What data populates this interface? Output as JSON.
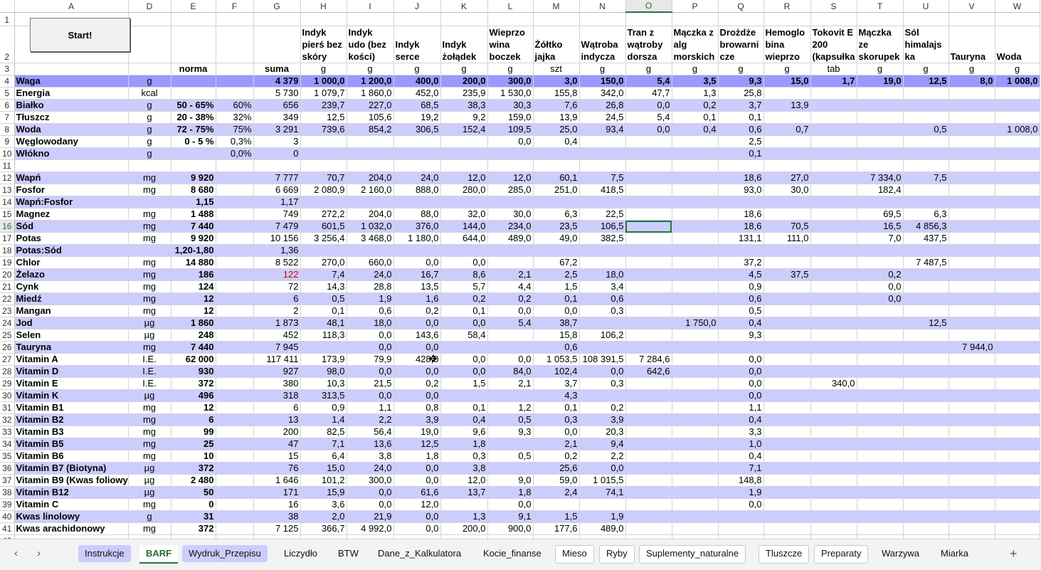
{
  "start_button": "Start!",
  "columns": [
    "A",
    "D",
    "E",
    "F",
    "G",
    "H",
    "I",
    "J",
    "K",
    "L",
    "M",
    "N",
    "O",
    "P",
    "Q",
    "R",
    "S",
    "T",
    "U",
    "V",
    "W"
  ],
  "selected_column": "O",
  "selected_row": "16",
  "row_numbers": [
    "1",
    "2",
    "3",
    "4",
    "5",
    "6",
    "7",
    "8",
    "9",
    "10",
    "11",
    "12",
    "13",
    "14",
    "15",
    "16",
    "17",
    "18",
    "19",
    "20",
    "21",
    "22",
    "23",
    "24",
    "25",
    "26",
    "27",
    "28",
    "29",
    "30",
    "31",
    "32",
    "33",
    "34",
    "35",
    "36",
    "37",
    "38",
    "39",
    "40",
    "41",
    "42"
  ],
  "ingredients": [
    "Indyk pierś bez skóry",
    "Indyk udo (bez kości)",
    "Indyk serce",
    "Indyk żołądek",
    "Wieprzowina boczek",
    "Żółtko jajka",
    "Wątroba indycza",
    "Tran z wątroby dorsza",
    "Mączka z alg morskich",
    "Drożdże browarnicze",
    "Hemoglobina wieprzo",
    "Tokovit E 200 (kapsułka",
    "Mączka ze skorupek",
    "Sól himalajska",
    "Tauryna",
    "Woda"
  ],
  "ingredients_display": [
    "Indyk pierś bez skóry",
    "Indyk udo (bez kości)",
    "Indyk serce",
    "Indyk żołądek",
    "Wieprzo wina boczek",
    "Żółtko jajka",
    "Wątroba indycza",
    "Tran z wątroby dorsza",
    "Mączka z alg morskich",
    "Drożdże browarni cze",
    "Hemoglo bina wieprzo",
    "Tokovit E 200 (kapsułka",
    "Mączka ze skorupek",
    "Sól himalajs ka",
    "Tauryna",
    "Woda"
  ],
  "row3": {
    "norma": "norma",
    "suma": "suma",
    "units": [
      "g",
      "g",
      "g",
      "g",
      "g",
      "szt",
      "g",
      "g",
      "g",
      "g",
      "g",
      "tab",
      "g",
      "g",
      "g",
      "g"
    ]
  },
  "rows": [
    {
      "n": "4",
      "name": "Waga",
      "unit": "g",
      "norma": "",
      "pct": "",
      "suma": "4 379",
      "vals": [
        "1 000,0",
        "1 200,0",
        "400,0",
        "200,0",
        "300,0",
        "3,0",
        "150,0",
        "5,4",
        "3,5",
        "9,3",
        "15,0",
        "1,7",
        "19,0",
        "12,5",
        "8,0",
        "1 008,0"
      ],
      "band": true,
      "bold": true
    },
    {
      "n": "5",
      "name": "Energia",
      "unit": "kcal",
      "norma": "",
      "pct": "",
      "suma": "5 730",
      "vals": [
        "1 079,7",
        "1 860,0",
        "452,0",
        "235,9",
        "1 530,0",
        "155,8",
        "342,0",
        "47,7",
        "1,3",
        "25,8",
        "",
        "",
        "",
        "",
        "",
        ""
      ],
      "band": false
    },
    {
      "n": "6",
      "name": "Białko",
      "unit": "g",
      "norma": "50 - 65%",
      "pct": "60%",
      "suma": "656",
      "vals": [
        "239,7",
        "227,0",
        "68,5",
        "38,3",
        "30,3",
        "7,6",
        "26,8",
        "0,0",
        "0,2",
        "3,7",
        "13,9",
        "",
        "",
        "",
        "",
        ""
      ],
      "band": true
    },
    {
      "n": "7",
      "name": "Tłuszcz",
      "unit": "g",
      "norma": "20 - 38%",
      "pct": "32%",
      "suma": "349",
      "vals": [
        "12,5",
        "105,6",
        "19,2",
        "9,2",
        "159,0",
        "13,9",
        "24,5",
        "5,4",
        "0,1",
        "0,1",
        "",
        "",
        "",
        "",
        "",
        ""
      ],
      "band": false
    },
    {
      "n": "8",
      "name": "Woda",
      "unit": "g",
      "norma": "72 - 75%",
      "pct": "75%",
      "suma": "3 291",
      "vals": [
        "739,6",
        "854,2",
        "306,5",
        "152,4",
        "109,5",
        "25,0",
        "93,4",
        "0,0",
        "0,4",
        "0,6",
        "0,7",
        "",
        "",
        "0,5",
        "",
        "1 008,0"
      ],
      "band": true
    },
    {
      "n": "9",
      "name": "Węglowodany",
      "unit": "g",
      "norma": "0 - 5 %",
      "pct": "0,3%",
      "suma": "3",
      "vals": [
        "",
        "",
        "",
        "",
        "0,0",
        "0,4",
        "",
        "",
        "",
        "2,5",
        "",
        "",
        "",
        "",
        "",
        ""
      ],
      "band": false
    },
    {
      "n": "10",
      "name": "Włókno",
      "unit": "g",
      "norma": "",
      "pct": "0,0%",
      "suma": "0",
      "vals": [
        "",
        "",
        "",
        "",
        "",
        "",
        "",
        "",
        "",
        "0,1",
        "",
        "",
        "",
        "",
        "",
        ""
      ],
      "band": true
    },
    {
      "n": "11",
      "name": "",
      "unit": "",
      "norma": "",
      "pct": "",
      "suma": "",
      "vals": [
        "",
        "",
        "",
        "",
        "",
        "",
        "",
        "",
        "",
        "",
        "",
        "",
        "",
        "",
        "",
        ""
      ],
      "band": false
    },
    {
      "n": "12",
      "name": "Wapń",
      "unit": "mg",
      "norma": "9 920",
      "pct": "",
      "suma": "7 777",
      "vals": [
        "70,7",
        "204,0",
        "24,0",
        "12,0",
        "12,0",
        "60,1",
        "7,5",
        "",
        "",
        "18,6",
        "27,0",
        "",
        "7 334,0",
        "7,5",
        "",
        ""
      ],
      "band": true
    },
    {
      "n": "13",
      "name": "Fosfor",
      "unit": "mg",
      "norma": "8 680",
      "pct": "",
      "suma": "6 669",
      "vals": [
        "2 080,9",
        "2 160,0",
        "888,0",
        "280,0",
        "285,0",
        "251,0",
        "418,5",
        "",
        "",
        "93,0",
        "30,0",
        "",
        "182,4",
        "",
        "",
        ""
      ],
      "band": false
    },
    {
      "n": "14",
      "name": "Wapń:Fosfor",
      "unit": "",
      "norma": "1,15",
      "pct": "",
      "suma": "1,17",
      "vals": [
        "",
        "",
        "",
        "",
        "",
        "",
        "",
        "",
        "",
        "",
        "",
        "",
        "",
        "",
        "",
        ""
      ],
      "band": true
    },
    {
      "n": "15",
      "name": "Magnez",
      "unit": "mg",
      "norma": "1 488",
      "pct": "",
      "suma": "749",
      "vals": [
        "272,2",
        "204,0",
        "88,0",
        "32,0",
        "30,0",
        "6,3",
        "22,5",
        "",
        "",
        "18,6",
        "",
        "",
        "69,5",
        "6,3",
        "",
        ""
      ],
      "band": false
    },
    {
      "n": "16",
      "name": "Sód",
      "unit": "mg",
      "norma": "7 440",
      "pct": "",
      "suma": "7 479",
      "vals": [
        "601,5",
        "1 032,0",
        "376,0",
        "144,0",
        "234,0",
        "23,5",
        "106,5",
        "",
        "",
        "18,6",
        "70,5",
        "",
        "16,5",
        "4 856,3",
        "",
        ""
      ],
      "band": true
    },
    {
      "n": "17",
      "name": "Potas",
      "unit": "mg",
      "norma": "9 920",
      "pct": "",
      "suma": "10 156",
      "vals": [
        "3 256,4",
        "3 468,0",
        "1 180,0",
        "644,0",
        "489,0",
        "49,0",
        "382,5",
        "",
        "",
        "131,1",
        "111,0",
        "",
        "7,0",
        "437,5",
        "",
        ""
      ],
      "band": false
    },
    {
      "n": "18",
      "name": "Potas:Sód",
      "unit": "",
      "norma": "1,20-1,80",
      "pct": "",
      "suma": "1,36",
      "vals": [
        "",
        "",
        "",
        "",
        "",
        "",
        "",
        "",
        "",
        "",
        "",
        "",
        "",
        "",
        "",
        ""
      ],
      "band": true
    },
    {
      "n": "19",
      "name": "Chlor",
      "unit": "mg",
      "norma": "14 880",
      "pct": "",
      "suma": "8 522",
      "vals": [
        "270,0",
        "660,0",
        "0,0",
        "0,0",
        "",
        "67,2",
        "",
        "",
        "",
        "37,2",
        "",
        "",
        "",
        "7 487,5",
        "",
        ""
      ],
      "band": false
    },
    {
      "n": "20",
      "name": "Żelazo",
      "unit": "mg",
      "norma": "186",
      "pct": "",
      "suma": "122",
      "sumaRed": true,
      "vals": [
        "7,4",
        "24,0",
        "16,7",
        "8,6",
        "2,1",
        "2,5",
        "18,0",
        "",
        "",
        "4,5",
        "37,5",
        "",
        "0,2",
        "",
        "",
        ""
      ],
      "band": true
    },
    {
      "n": "21",
      "name": "Cynk",
      "unit": "mg",
      "norma": "124",
      "pct": "",
      "suma": "72",
      "vals": [
        "14,3",
        "28,8",
        "13,5",
        "5,7",
        "4,4",
        "1,5",
        "3,4",
        "",
        "",
        "0,9",
        "",
        "",
        "0,0",
        "",
        "",
        ""
      ],
      "band": false
    },
    {
      "n": "22",
      "name": "Miedź",
      "unit": "mg",
      "norma": "12",
      "pct": "",
      "suma": "6",
      "vals": [
        "0,5",
        "1,9",
        "1,6",
        "0,2",
        "0,2",
        "0,1",
        "0,6",
        "",
        "",
        "0,6",
        "",
        "",
        "0,0",
        "",
        "",
        ""
      ],
      "band": true
    },
    {
      "n": "23",
      "name": "Mangan",
      "unit": "mg",
      "norma": "12",
      "pct": "",
      "suma": "2",
      "vals": [
        "0,1",
        "0,6",
        "0,2",
        "0,1",
        "0,0",
        "0,0",
        "0,3",
        "",
        "",
        "0,5",
        "",
        "",
        "",
        "",
        "",
        ""
      ],
      "band": false
    },
    {
      "n": "24",
      "name": "Jod",
      "unit": "µg",
      "norma": "1 860",
      "pct": "",
      "suma": "1 873",
      "vals": [
        "48,1",
        "18,0",
        "0,0",
        "0,0",
        "5,4",
        "38,7",
        "",
        "",
        "1 750,0",
        "0,4",
        "",
        "",
        "",
        "12,5",
        "",
        ""
      ],
      "band": true
    },
    {
      "n": "25",
      "name": "Selen",
      "unit": "µg",
      "norma": "248",
      "pct": "",
      "suma": "452",
      "vals": [
        "118,3",
        "0,0",
        "143,6",
        "58,4",
        "",
        "15,8",
        "106,2",
        "",
        "",
        "9,3",
        "",
        "",
        "",
        "",
        "",
        ""
      ],
      "band": false
    },
    {
      "n": "26",
      "name": "Tauryna",
      "unit": "mg",
      "norma": "7 440",
      "pct": "",
      "suma": "7 945",
      "vals": [
        "",
        "0,0",
        "0,0",
        "",
        "",
        "0,6",
        "",
        "",
        "",
        "",
        "",
        "",
        "",
        "",
        "7 944,0",
        ""
      ],
      "band": true
    },
    {
      "n": "27",
      "name": "Vitamin A",
      "unit": "I.E.",
      "norma": "62 000",
      "pct": "",
      "suma": "117 411",
      "vals": [
        "173,9",
        "79,9",
        "428,0",
        "0,0",
        "0,0",
        "1 053,5",
        "108 391,5",
        "7 284,6",
        "",
        "0,0",
        "",
        "",
        "",
        "",
        "",
        ""
      ],
      "band": false
    },
    {
      "n": "28",
      "name": "Vitamin D",
      "unit": "I.E.",
      "norma": "930",
      "pct": "",
      "suma": "927",
      "vals": [
        "98,0",
        "0,0",
        "0,0",
        "0,0",
        "84,0",
        "102,4",
        "0,0",
        "642,6",
        "",
        "0,0",
        "",
        "",
        "",
        "",
        "",
        ""
      ],
      "band": true
    },
    {
      "n": "29",
      "name": "Vitamin E",
      "unit": "I.E.",
      "norma": "372",
      "pct": "",
      "suma": "380",
      "vals": [
        "10,3",
        "21,5",
        "0,2",
        "1,5",
        "2,1",
        "3,7",
        "0,3",
        "",
        "",
        "0,0",
        "",
        "340,0",
        "",
        "",
        "",
        ""
      ],
      "band": false
    },
    {
      "n": "30",
      "name": "Vitamin K",
      "unit": "µg",
      "norma": "496",
      "pct": "",
      "suma": "318",
      "vals": [
        "313,5",
        "0,0",
        "0,0",
        "",
        "",
        "4,3",
        "",
        "",
        "",
        "0,0",
        "",
        "",
        "",
        "",
        "",
        ""
      ],
      "band": true
    },
    {
      "n": "31",
      "name": "Vitamin B1",
      "unit": "mg",
      "norma": "12",
      "pct": "",
      "suma": "6",
      "vals": [
        "0,9",
        "1,1",
        "0,8",
        "0,1",
        "1,2",
        "0,1",
        "0,2",
        "",
        "",
        "1,1",
        "",
        "",
        "",
        "",
        "",
        ""
      ],
      "band": false
    },
    {
      "n": "32",
      "name": "Vitamin B2",
      "unit": "mg",
      "norma": "6",
      "pct": "",
      "suma": "13",
      "vals": [
        "1,4",
        "2,2",
        "3,9",
        "0,4",
        "0,5",
        "0,3",
        "3,9",
        "",
        "",
        "0,4",
        "",
        "",
        "",
        "",
        "",
        ""
      ],
      "band": true
    },
    {
      "n": "33",
      "name": "Vitamin B3",
      "unit": "mg",
      "norma": "99",
      "pct": "",
      "suma": "200",
      "vals": [
        "82,5",
        "56,4",
        "19,0",
        "9,6",
        "9,3",
        "0,0",
        "20,3",
        "",
        "",
        "3,3",
        "",
        "",
        "",
        "",
        "",
        ""
      ],
      "band": false
    },
    {
      "n": "34",
      "name": "Vitamin B5",
      "unit": "mg",
      "norma": "25",
      "pct": "",
      "suma": "47",
      "vals": [
        "7,1",
        "13,6",
        "12,5",
        "1,8",
        "",
        "2,1",
        "9,4",
        "",
        "",
        "1,0",
        "",
        "",
        "",
        "",
        "",
        ""
      ],
      "band": true
    },
    {
      "n": "35",
      "name": "Vitamin B6",
      "unit": "mg",
      "norma": "10",
      "pct": "",
      "suma": "15",
      "vals": [
        "6,4",
        "3,8",
        "1,8",
        "0,3",
        "0,5",
        "0,2",
        "2,2",
        "",
        "",
        "0,4",
        "",
        "",
        "",
        "",
        "",
        ""
      ],
      "band": false
    },
    {
      "n": "36",
      "name": "Vitamin B7 (Biotyna)",
      "unit": "µg",
      "norma": "372",
      "pct": "",
      "suma": "76",
      "vals": [
        "15,0",
        "24,0",
        "0,0",
        "3,8",
        "",
        "25,6",
        "0,0",
        "",
        "",
        "7,1",
        "",
        "",
        "",
        "",
        "",
        ""
      ],
      "band": true
    },
    {
      "n": "37",
      "name": "Vitamin B9 (Kwas foliowy)",
      "unit": "µg",
      "norma": "2 480",
      "pct": "",
      "suma": "1 646",
      "vals": [
        "101,2",
        "300,0",
        "0,0",
        "12,0",
        "9,0",
        "59,0",
        "1 015,5",
        "",
        "",
        "148,8",
        "",
        "",
        "",
        "",
        "",
        ""
      ],
      "band": false
    },
    {
      "n": "38",
      "name": "Vitamin B12",
      "unit": "µg",
      "norma": "50",
      "pct": "",
      "suma": "171",
      "vals": [
        "15,9",
        "0,0",
        "61,6",
        "13,7",
        "1,8",
        "2,4",
        "74,1",
        "",
        "",
        "1,9",
        "",
        "",
        "",
        "",
        "",
        ""
      ],
      "band": true
    },
    {
      "n": "39",
      "name": "Vitamin C",
      "unit": "mg",
      "norma": "0",
      "pct": "",
      "suma": "16",
      "vals": [
        "3,6",
        "0,0",
        "12,0",
        "",
        "0,0",
        "",
        "",
        "",
        "",
        "0,0",
        "",
        "",
        "",
        "",
        "",
        ""
      ],
      "band": false
    },
    {
      "n": "40",
      "name": "Kwas linolowy",
      "unit": "g",
      "norma": "31",
      "pct": "",
      "suma": "38",
      "vals": [
        "2,0",
        "21,9",
        "0,0",
        "1,3",
        "9,1",
        "1,5",
        "1,9",
        "",
        "",
        "",
        "",
        "",
        "",
        "",
        "",
        ""
      ],
      "band": true
    },
    {
      "n": "41",
      "name": "Kwas arachidonowy",
      "unit": "mg",
      "norma": "372",
      "pct": "",
      "suma": "7 125",
      "vals": [
        "366,7",
        "4 992,0",
        "0,0",
        "200,0",
        "900,0",
        "177,6",
        "489,0",
        "",
        "",
        "",
        "",
        "",
        "",
        "",
        "",
        ""
      ],
      "band": false
    }
  ],
  "tabs": [
    {
      "label": "Instrukcje",
      "style": "purple"
    },
    {
      "label": "BARF",
      "style": "active"
    },
    {
      "label": "Wydruk_Przepisu",
      "style": "purple"
    },
    {
      "label": "Liczydło",
      "style": "plain"
    },
    {
      "label": "BTW",
      "style": "plain"
    },
    {
      "label": "Dane_z_Kalkulatora",
      "style": "plain"
    },
    {
      "label": "Kocie_finanse",
      "style": "plain"
    },
    {
      "label": "Mieso",
      "style": "white"
    },
    {
      "label": "Ryby",
      "style": "white"
    },
    {
      "label": "Suplementy_naturalne",
      "style": "white"
    },
    {
      "label": "Tluszcze",
      "style": "white"
    },
    {
      "label": "Preparaty",
      "style": "white"
    },
    {
      "label": "Warzywa",
      "style": "plain"
    },
    {
      "label": "Miarka",
      "style": "plain"
    }
  ],
  "nav": {
    "prev": "‹",
    "next": "›",
    "add": "+"
  },
  "icons": {
    "prev": "chevron-left-icon",
    "next": "chevron-right-icon",
    "add": "plus-icon",
    "cursor": "move-cursor-icon"
  },
  "colors": {
    "band": "#ccccff",
    "weight_band": "#9999ff",
    "selection": "#217346",
    "warning": "#d00000"
  }
}
